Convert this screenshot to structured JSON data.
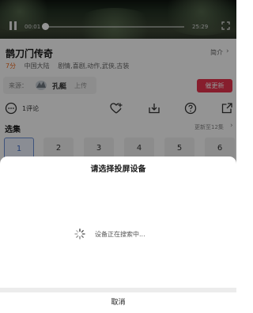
{
  "player": {
    "current_time": "00:01",
    "total_time": "25:29",
    "progress": 0.0
  },
  "show": {
    "title": "鹊刀门传奇",
    "intro_label": "简介",
    "rating": "7分",
    "region": "中国大陆",
    "genres": "剧情,喜剧,动作,武侠,古装",
    "source_label": "来源：",
    "uploader": "孔艇",
    "upload_label": "上传",
    "remind_label": "催更新",
    "comment_count": "1评论"
  },
  "episodes": {
    "heading": "选集",
    "update_info": "更新至12集",
    "items": [
      "1",
      "2",
      "3",
      "4",
      "5",
      "6"
    ]
  },
  "cast_sheet": {
    "title": "请选择投屏设备",
    "status": "设备正在搜索中...",
    "cancel_label": "取消"
  },
  "colors": {
    "accent": "#e8344e",
    "rating": "#ee6a1e",
    "selected_episode": "#3d6cc9"
  },
  "icons": [
    "play-pause-icon",
    "fullscreen-icon",
    "comment-icon",
    "favorite-add-icon",
    "download-icon",
    "help-icon",
    "share-icon",
    "loading-spinner-icon",
    "chevron-right-icon"
  ]
}
